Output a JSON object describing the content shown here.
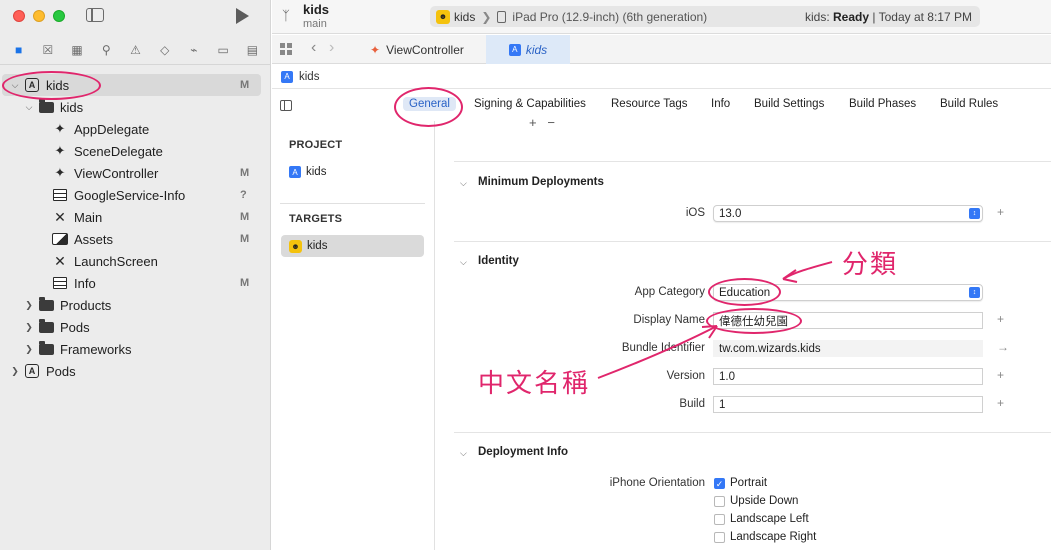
{
  "navigator": {
    "tree": [
      {
        "label": "kids",
        "badge": "M",
        "indent": 0,
        "icon": "app-icon",
        "disclosure": "open",
        "selected": true
      },
      {
        "label": "kids",
        "badge": "",
        "indent": 1,
        "icon": "folder-icon",
        "disclosure": "open"
      },
      {
        "label": "AppDelegate",
        "badge": "",
        "indent": 2,
        "icon": "swift-file-icon"
      },
      {
        "label": "SceneDelegate",
        "badge": "",
        "indent": 2,
        "icon": "swift-file-icon"
      },
      {
        "label": "ViewController",
        "badge": "M",
        "indent": 2,
        "icon": "swift-file-icon"
      },
      {
        "label": "GoogleService-Info",
        "badge": "?",
        "indent": 2,
        "icon": "plist-icon"
      },
      {
        "label": "Main",
        "badge": "M",
        "indent": 2,
        "icon": "storyboard-icon"
      },
      {
        "label": "Assets",
        "badge": "M",
        "indent": 2,
        "icon": "assets-icon"
      },
      {
        "label": "LaunchScreen",
        "badge": "",
        "indent": 2,
        "icon": "storyboard-icon"
      },
      {
        "label": "Info",
        "badge": "M",
        "indent": 2,
        "icon": "plist-icon"
      },
      {
        "label": "Products",
        "badge": "",
        "indent": 1,
        "icon": "folder-icon",
        "disclosure": "closed"
      },
      {
        "label": "Pods",
        "badge": "",
        "indent": 1,
        "icon": "folder-icon",
        "disclosure": "closed"
      },
      {
        "label": "Frameworks",
        "badge": "",
        "indent": 1,
        "icon": "folder-icon",
        "disclosure": "closed"
      },
      {
        "label": "Pods",
        "badge": "",
        "indent": 0,
        "icon": "app-icon",
        "disclosure": "closed"
      }
    ]
  },
  "header": {
    "project": "kids",
    "branch": "main",
    "scheme": "kids",
    "device": "iPad Pro (12.9-inch) (6th generation)",
    "status_prefix": "kids: ",
    "status_bold": "Ready",
    "status_suffix": " | Today at 8:17 PM"
  },
  "tabs": {
    "file_tab": "ViewController",
    "project_tab": "kids"
  },
  "breadcrumb": "kids",
  "settings_tabs": [
    "General",
    "Signing & Capabilities",
    "Resource Tags",
    "Info",
    "Build Settings",
    "Build Phases",
    "Build Rules"
  ],
  "project_list": {
    "project_header": "PROJECT",
    "project_item": "kids",
    "targets_header": "TARGETS",
    "target_item": "kids"
  },
  "min_deployments": {
    "title": "Minimum Deployments",
    "ios_label": "iOS",
    "ios_value": "13.0"
  },
  "identity": {
    "title": "Identity",
    "app_category_label": "App Category",
    "app_category_value": "Education",
    "display_name_label": "Display Name",
    "display_name_value": "偉德仕幼兒園",
    "bundle_id_label": "Bundle Identifier",
    "bundle_id_value": "tw.com.wizards.kids",
    "version_label": "Version",
    "version_value": "1.0",
    "build_label": "Build",
    "build_value": "1"
  },
  "deployment_info": {
    "title": "Deployment Info",
    "orientation_label": "iPhone Orientation",
    "options": [
      {
        "label": "Portrait",
        "checked": true
      },
      {
        "label": "Upside Down",
        "checked": false
      },
      {
        "label": "Landscape Left",
        "checked": false
      },
      {
        "label": "Landscape Right",
        "checked": false
      }
    ]
  },
  "annotations": {
    "category_note": "分類",
    "name_note": "中文名稱",
    "color": "#e0266c"
  }
}
